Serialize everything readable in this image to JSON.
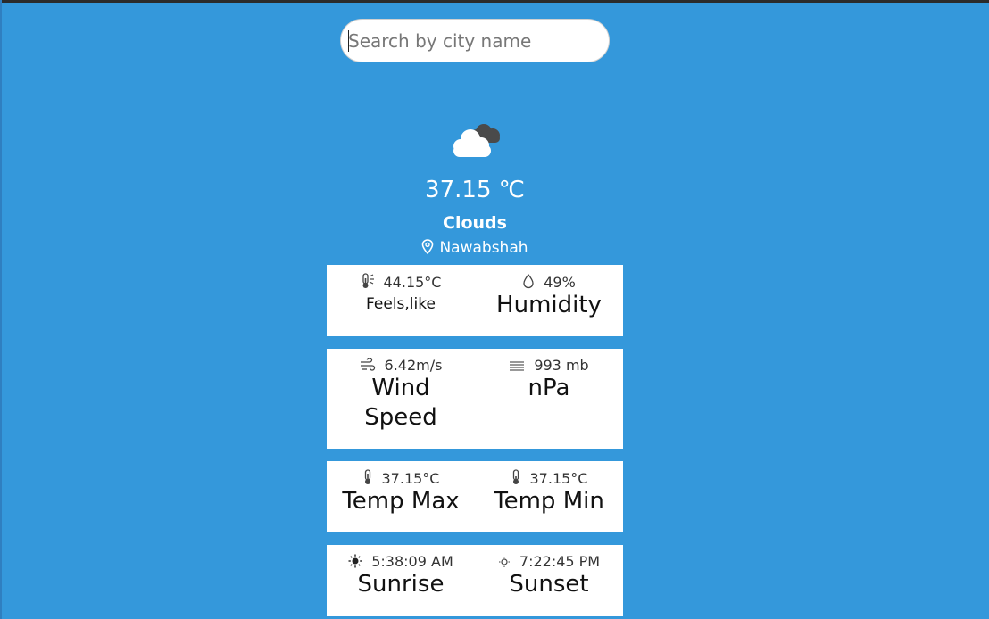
{
  "search": {
    "placeholder": "Search by city name"
  },
  "current": {
    "icon": "clouds-icon",
    "temperature": "37.15 ℃",
    "condition": "Clouds",
    "city": "Nawabshah"
  },
  "cards": [
    {
      "left": {
        "icon": "thermometer-half-icon",
        "value": "44.15°C",
        "label": "Feels,like"
      },
      "right": {
        "icon": "droplet-icon",
        "value": "49%",
        "label": "Humidity"
      }
    },
    {
      "left": {
        "icon": "wind-icon",
        "value": "6.42m/s",
        "label_line1": "Wind",
        "label_line2": "Speed"
      },
      "right": {
        "icon": "pressure-icon",
        "value": "993 mb",
        "label": "nPa"
      }
    },
    {
      "left": {
        "icon": "thermometer-icon",
        "value": "37.15°C",
        "label": "Temp Max"
      },
      "right": {
        "icon": "thermometer-icon",
        "value": "37.15°C",
        "label": "Temp Min"
      }
    },
    {
      "left": {
        "icon": "sunrise-icon",
        "value": "5:38:09 AM",
        "label": "Sunrise"
      },
      "right": {
        "icon": "sunset-icon",
        "value": "7:22:45 PM",
        "label": "Sunset"
      }
    }
  ],
  "colors": {
    "background": "#3498db",
    "card": "#ffffff",
    "text": "#111111"
  }
}
